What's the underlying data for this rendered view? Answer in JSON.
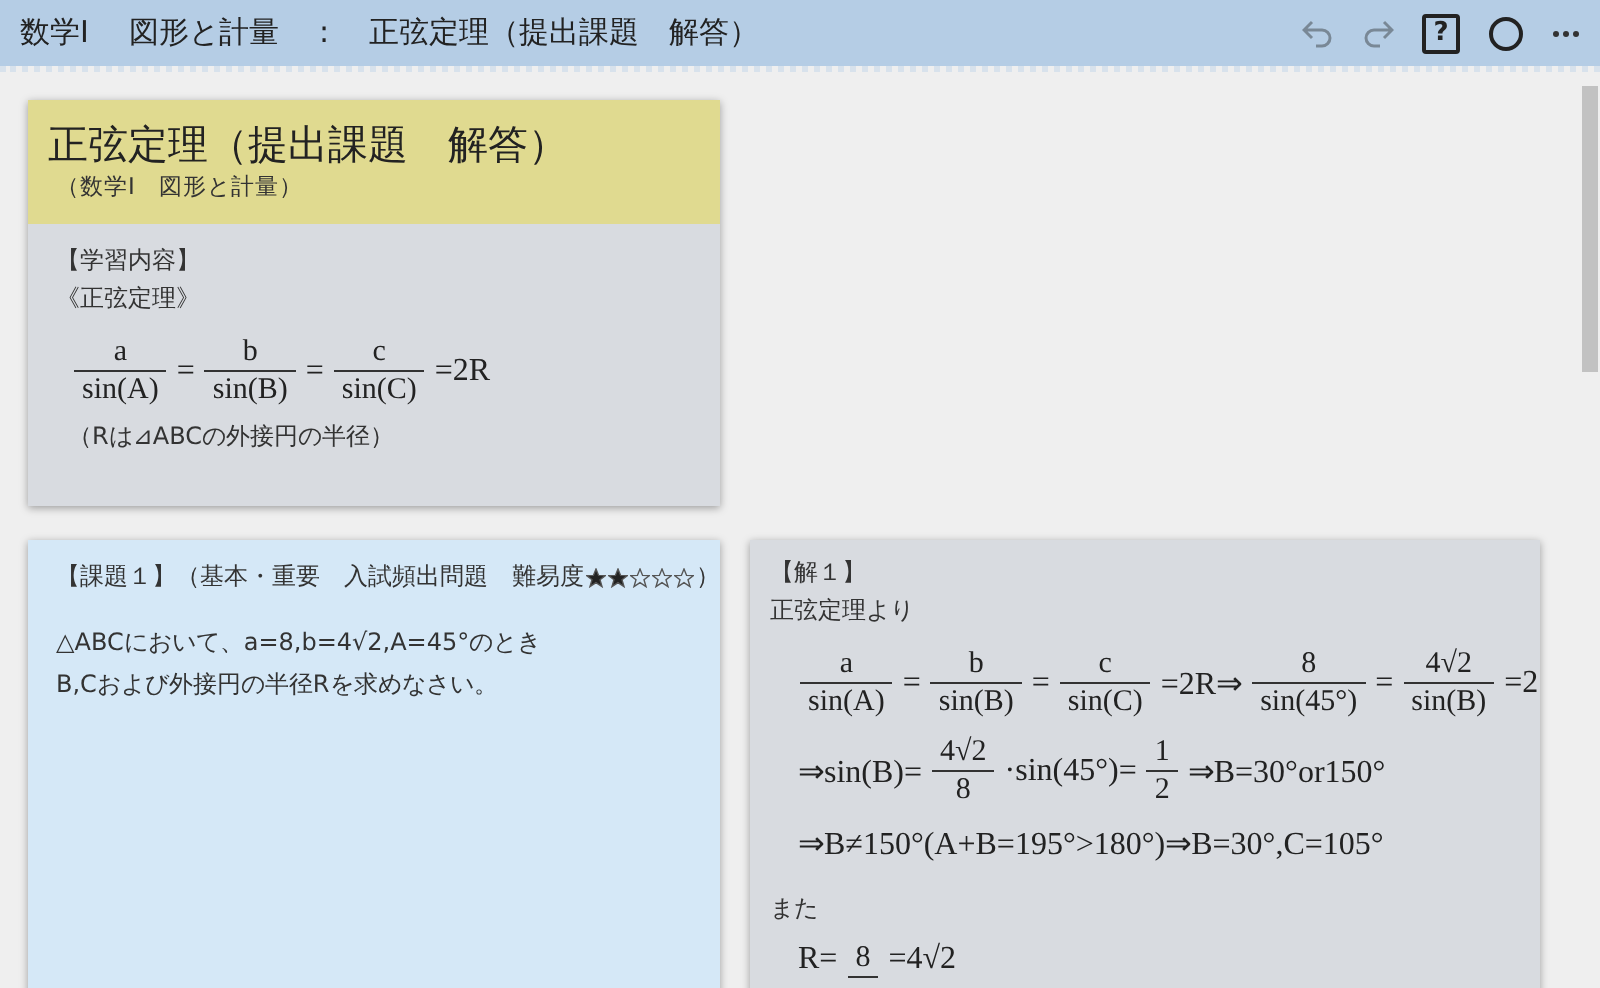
{
  "header": {
    "breadcrumb": [
      "数学Ⅰ",
      "図形と計量",
      ":",
      "正弦定理（提出課題　解答）"
    ],
    "undo": {
      "disabled": true
    },
    "redo": {
      "disabled": true
    },
    "help_label": "?"
  },
  "summary_card": {
    "title": "正弦定理（提出課題　解答）",
    "subtitle": "（数学Ⅰ　図形と計量）",
    "section": "【学習内容】",
    "theorem": "《正弦定理》",
    "formula": [
      {
        "num": "a",
        "den": "sin(A)"
      },
      "=",
      {
        "num": "b",
        "den": "sin(B)"
      },
      "=",
      {
        "num": "c",
        "den": "sin(C)"
      },
      "=2R"
    ],
    "note": "（Rは⊿ABCの外接円の半径）"
  },
  "task_card": {
    "heading": "【課題１】（基本・重要　入試頻出問題　難易度",
    "stars": 2,
    "heading_end": "）",
    "lines": [
      "△ABCにおいて、a=8,b=4√2,A=45°のとき",
      "B,Cおよび外接円の半径Rを求めなさい。"
    ]
  },
  "solution_card": {
    "heading": "【解１】",
    "lines": [
      {
        "kind": "text",
        "text": "正弦定理より"
      },
      {
        "kind": "formula",
        "tokens": [
          {
            "num": "a",
            "den": "sin(A)"
          },
          "=",
          {
            "num": "b",
            "den": "sin(B)"
          },
          "=",
          {
            "num": "c",
            "den": "sin(C)"
          },
          "=2R⇒",
          {
            "num": "8",
            "den": "sin(45°)"
          },
          "=",
          {
            "num": "4√2",
            "den": "sin(B)"
          },
          "=2"
        ]
      },
      {
        "kind": "formula",
        "tokens": [
          "⇒sin(B)=",
          {
            "num": "4√2",
            "den": "8"
          },
          "·sin(45°)=",
          {
            "num": "1",
            "den": "2"
          },
          "⇒B=30°or150°"
        ]
      },
      {
        "kind": "formula",
        "tokens": [
          "⇒B≠150°(A+B=195°>180°)⇒B=30°,C=105°"
        ]
      },
      {
        "kind": "text",
        "text": "また"
      },
      {
        "kind": "formula",
        "tokens": [
          "R=",
          {
            "num": "8"
          },
          "=4√2"
        ]
      }
    ]
  }
}
